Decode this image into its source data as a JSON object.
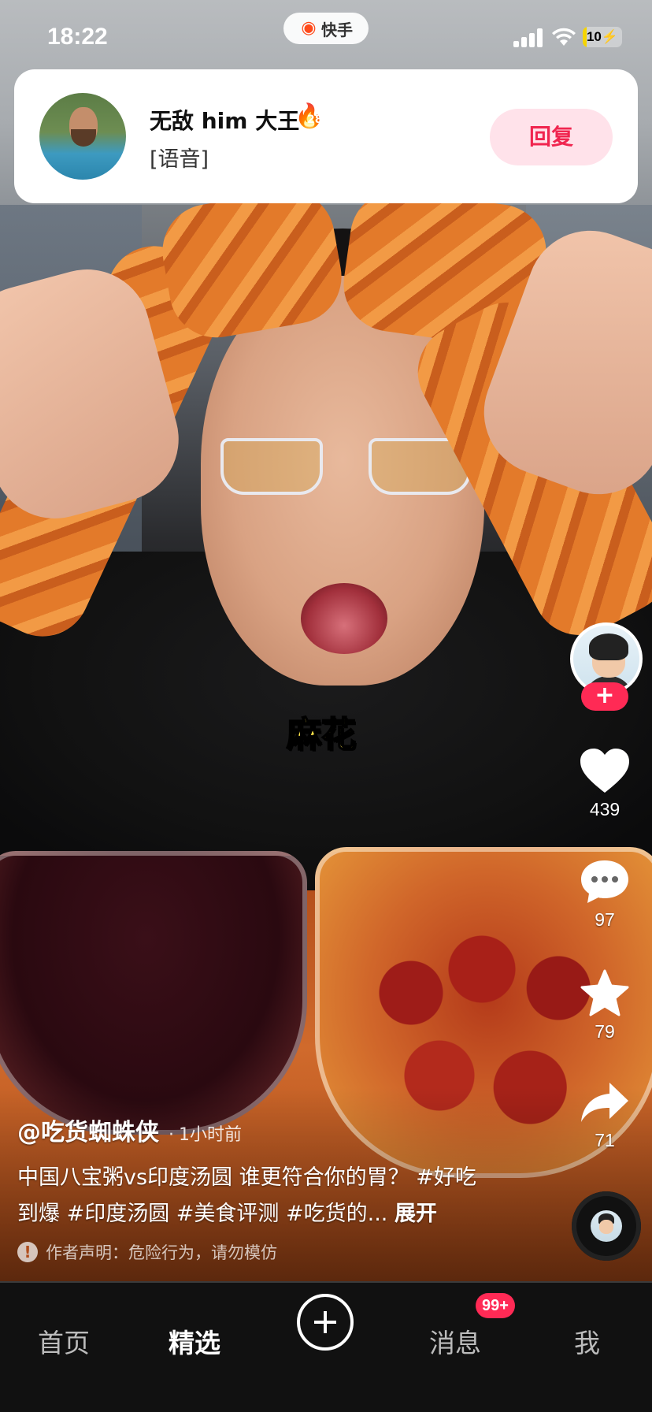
{
  "status_bar": {
    "time": "18:22",
    "app_name": "快手",
    "battery_text": "10",
    "battery_level_percent": 10
  },
  "notification": {
    "sender": "无敌 him 大王",
    "fire_level": "28",
    "preview": "[语音]",
    "reply_label": "回复",
    "reply_color": "#f0254f"
  },
  "video": {
    "subtitle": "麻花"
  },
  "actions": {
    "follow_symbol": "+",
    "likes": "439",
    "comments": "97",
    "favorites": "79",
    "shares": "71"
  },
  "info": {
    "author": "@吃货蜘蛛侠",
    "separator": "·",
    "posted": "1小时前",
    "description": "中国八宝粥vs印度汤圆 谁更符合你的胃？ #好吃到爆 #印度汤圆 #美食评测 #吃货的... ",
    "expand_label": "展开",
    "warning_icon": "!",
    "warning": "作者声明：危险行为，请勿模仿"
  },
  "tabbar": {
    "home": "首页",
    "featured": "精选",
    "messages": "消息",
    "messages_badge": "99+",
    "me": "我",
    "active_tab": "精选"
  },
  "colors": {
    "accent": "#ff2a55",
    "tabbar_bg": "#111111"
  },
  "icons": {
    "like": "heart-icon",
    "comment": "comment-bubble-icon",
    "favorite": "star-icon",
    "share": "share-arrow-icon",
    "add": "plus-icon",
    "warning": "exclamation-icon"
  }
}
